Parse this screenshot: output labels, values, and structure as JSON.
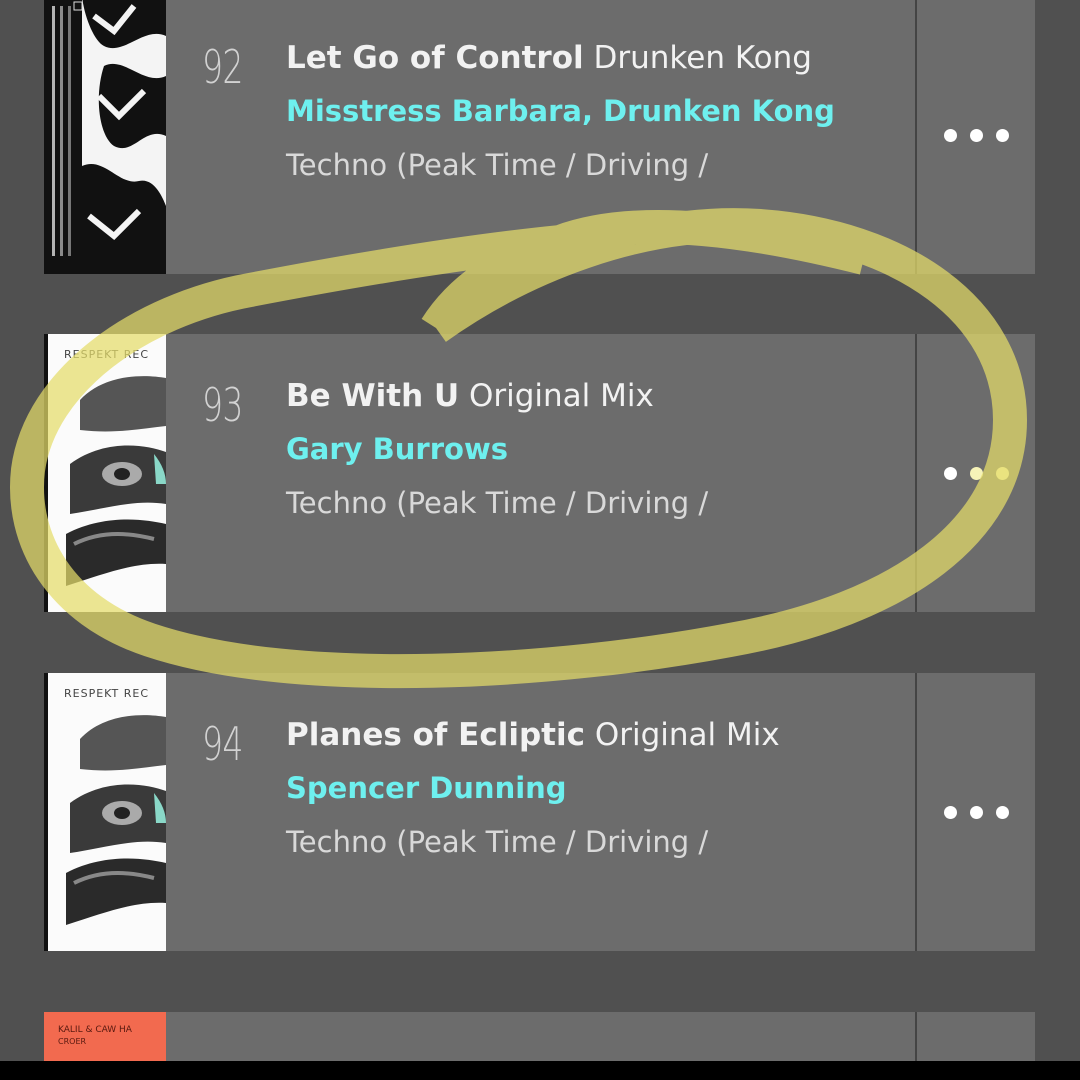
{
  "tracks": [
    {
      "rank": "92",
      "title": "Let Go of Control",
      "mix": "Drunken Kong",
      "artists": "Misstress Barbara, Drunken Kong",
      "genre": "Techno (Peak Time / Driving /"
    },
    {
      "rank": "93",
      "title": "Be With U",
      "mix": "Original Mix",
      "artists": "Gary Burrows",
      "genre": "Techno (Peak Time / Driving /",
      "cover_label": "RESPEKT REC"
    },
    {
      "rank": "94",
      "title": "Planes of Ecliptic",
      "mix": "Original Mix",
      "artists": "Spencer Dunning",
      "genre": "Techno (Peak Time / Driving /",
      "cover_label": "RESPEKT REC"
    },
    {
      "cover_label": "KALIL & CAW HA",
      "cover_sub": "CROER"
    }
  ],
  "colors": {
    "artist": "#6ef0ef",
    "annotation": "#e4dc6a"
  },
  "icons": {
    "more": "more-horizontal-icon"
  }
}
